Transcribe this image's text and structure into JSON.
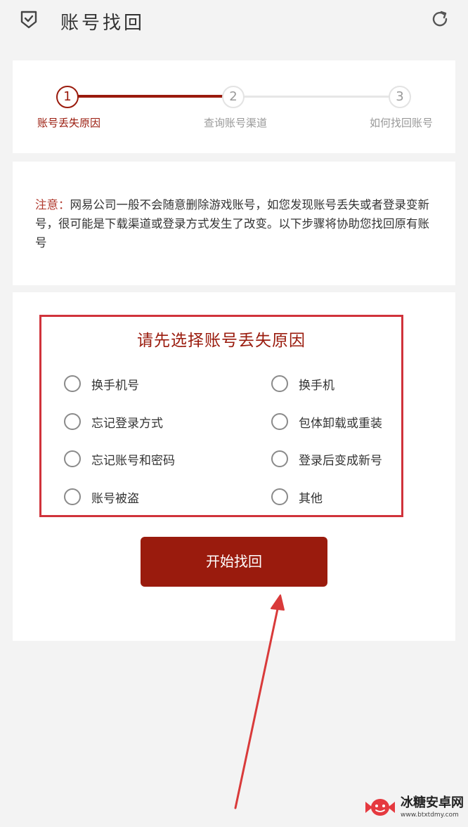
{
  "header": {
    "title": "账号找回",
    "menu_icon": "shield-check-icon",
    "refresh_icon": "refresh-icon"
  },
  "steps": [
    {
      "number": "1",
      "label": "账号丢失原因",
      "active": true
    },
    {
      "number": "2",
      "label": "查询账号渠道",
      "active": false
    },
    {
      "number": "3",
      "label": "如何找回账号",
      "active": false
    }
  ],
  "notice": {
    "prefix": "注意：",
    "text": "网易公司一般不会随意删除游戏账号，如您发现账号丢失或者登录变新号，很可能是下载渠道或登录方式发生了改变。以下步骤将协助您找回原有账号"
  },
  "reasons": {
    "title": "请先选择账号丢失原因",
    "options": [
      "换手机号",
      "换手机",
      "忘记登录方式",
      "包体卸载或重装",
      "忘记账号和密码",
      "登录后变成新号",
      "账号被盗",
      "其他"
    ]
  },
  "start_button": "开始找回",
  "watermark": {
    "name": "冰糖安卓网",
    "url": "www.btxtdmy.com"
  },
  "colors": {
    "accent": "#9a1b0d",
    "highlight_box": "#d0333b",
    "annotation_arrow": "#d93a3a"
  }
}
